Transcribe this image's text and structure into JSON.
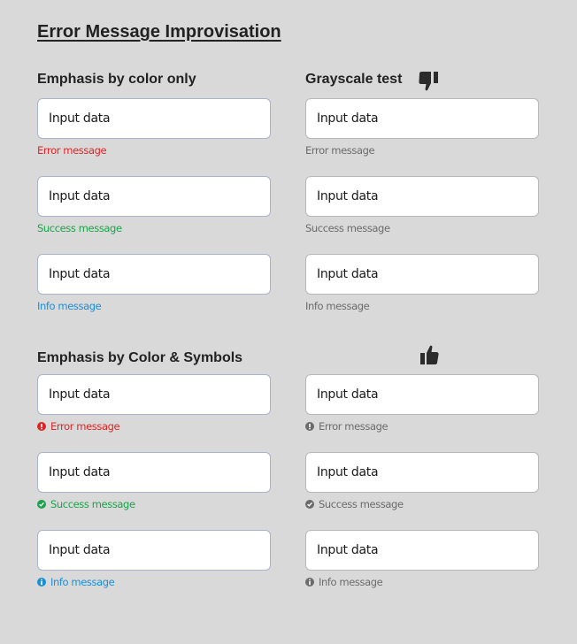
{
  "title": "Error Message Improvisation",
  "colors": {
    "error": "#e02424",
    "success": "#1aa34a",
    "info": "#1a8fd6",
    "gray": "#6b6b6b",
    "heading": "#222222",
    "background": "#d9d9d9"
  },
  "sections": {
    "color_only": {
      "heading": "Emphasis by color only",
      "fields": [
        {
          "value": "Input data",
          "message": "Error message",
          "type": "error"
        },
        {
          "value": "Input data",
          "message": "Success message",
          "type": "success"
        },
        {
          "value": "Input data",
          "message": "Info message",
          "type": "info"
        }
      ]
    },
    "grayscale_color_only": {
      "heading": "Grayscale test",
      "verdict_icon": "thumbs-down-icon",
      "fields": [
        {
          "value": "Input data",
          "message": "Error message",
          "type": "gray"
        },
        {
          "value": "Input data",
          "message": "Success message",
          "type": "gray"
        },
        {
          "value": "Input data",
          "message": "Info message",
          "type": "gray"
        }
      ]
    },
    "color_symbols": {
      "heading": "Emphasis by Color & Symbols",
      "fields": [
        {
          "value": "Input data",
          "message": "Error message",
          "type": "error",
          "icon": "exclamation-circle-icon"
        },
        {
          "value": "Input data",
          "message": "Success message",
          "type": "success",
          "icon": "check-circle-icon"
        },
        {
          "value": "Input data",
          "message": "Info message",
          "type": "info",
          "icon": "info-circle-icon"
        }
      ]
    },
    "grayscale_symbols": {
      "verdict_icon": "thumbs-up-icon",
      "fields": [
        {
          "value": "Input data",
          "message": "Error message",
          "type": "gray",
          "icon": "exclamation-circle-icon"
        },
        {
          "value": "Input data",
          "message": "Success message",
          "type": "gray",
          "icon": "check-circle-icon"
        },
        {
          "value": "Input data",
          "message": "Info message",
          "type": "gray",
          "icon": "info-circle-icon"
        }
      ]
    }
  }
}
